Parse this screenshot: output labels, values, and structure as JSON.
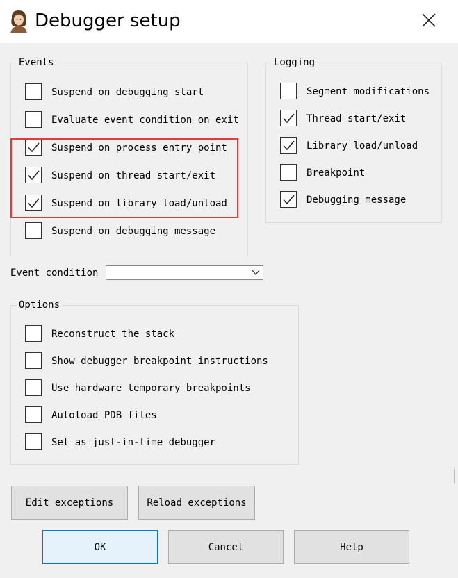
{
  "window": {
    "title": "Debugger setup",
    "close_label": "close"
  },
  "events": {
    "legend": "Events",
    "items": [
      {
        "label": "Suspend on debugging start",
        "checked": false
      },
      {
        "label": "Evaluate event condition on exit",
        "checked": false
      },
      {
        "label": "Suspend on process entry point",
        "checked": true
      },
      {
        "label": "Suspend on thread start/exit",
        "checked": true
      },
      {
        "label": "Suspend on library load/unload",
        "checked": true
      },
      {
        "label": "Suspend on debugging message",
        "checked": false
      }
    ]
  },
  "logging": {
    "legend": "Logging",
    "items": [
      {
        "label": "Segment modifications",
        "checked": false
      },
      {
        "label": "Thread start/exit",
        "checked": true
      },
      {
        "label": "Library load/unload",
        "checked": true
      },
      {
        "label": "Breakpoint",
        "checked": false
      },
      {
        "label": "Debugging message",
        "checked": true
      }
    ]
  },
  "event_condition": {
    "label": "Event condition",
    "value": ""
  },
  "options": {
    "legend": "Options",
    "items": [
      {
        "label": "Reconstruct the stack",
        "checked": false
      },
      {
        "label": "Show debugger breakpoint instructions",
        "checked": false
      },
      {
        "label": "Use hardware temporary breakpoints",
        "checked": false
      },
      {
        "label": "Autoload PDB files",
        "checked": false
      },
      {
        "label": "Set as just-in-time debugger",
        "checked": false
      }
    ]
  },
  "buttons": {
    "edit_exceptions": "Edit exceptions",
    "reload_exceptions": "Reload exceptions",
    "ok": "OK",
    "cancel": "Cancel",
    "help": "Help"
  },
  "colors": {
    "highlight": "#e53935",
    "default_button_border": "#0078d7"
  },
  "icons": {
    "app": "portrait-icon",
    "close": "close-icon",
    "check": "checkmark-icon",
    "dropdown": "chevron-down-icon"
  }
}
